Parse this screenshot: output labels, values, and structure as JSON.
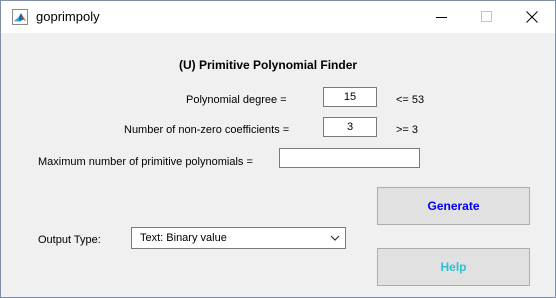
{
  "window": {
    "title": "goprimpoly",
    "app_icon": "matlab-icon",
    "controls": [
      "minimize-icon",
      "maximize-icon",
      "close-icon"
    ]
  },
  "form": {
    "heading": "(U) Primitive Polynomial Finder",
    "degree": {
      "label": "Polynomial degree =",
      "value": "15",
      "constraint": "<= 53"
    },
    "coefficients": {
      "label": "Number of non-zero coefficients =",
      "value": "3",
      "constraint": ">= 3"
    },
    "max_polys": {
      "label": "Maximum number of primitive polynomials =",
      "value": ""
    },
    "output_type": {
      "label": "Output Type:",
      "selected": "Text: Binary value"
    }
  },
  "buttons": {
    "generate": "Generate",
    "help": "Help"
  },
  "colors": {
    "generate_text": "#0000ee",
    "help_text": "#2cc1d4",
    "button_bg": "#e1e1e1",
    "window_bg": "#f0f0f0",
    "matlab_icon_orange": "#d95319",
    "matlab_icon_blue": "#0072bd"
  }
}
